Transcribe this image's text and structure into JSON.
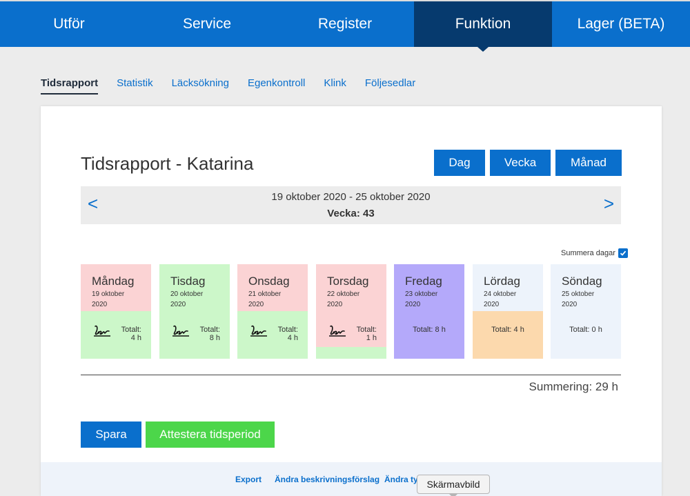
{
  "nav": {
    "items": [
      "Utför",
      "Service",
      "Register",
      "Funktion",
      "Lager (BETA)"
    ],
    "active": "Funktion"
  },
  "subtabs": {
    "items": [
      "Tidsrapport",
      "Statistik",
      "Läcksökning",
      "Egenkontroll",
      "Klink",
      "Följesedlar"
    ],
    "active": "Tidsrapport"
  },
  "report": {
    "title": "Tidsrapport - Katarina",
    "modes": [
      "Dag",
      "Vecka",
      "Månad"
    ],
    "date_range": "19 oktober 2020 - 25 oktober 2020",
    "week_label": "Vecka: 43",
    "prev_icon": "<",
    "next_icon": ">",
    "summera_label": "Summera dagar",
    "summera_checked": true
  },
  "days": [
    {
      "name": "Måndag",
      "date": "19 oktober",
      "year": "2020",
      "total_label": "Totalt:",
      "total": "4 h",
      "signed": true,
      "head_color": "#fbd3d4",
      "body_color": "#ccf7c9"
    },
    {
      "name": "Tisdag",
      "date": "20 oktober",
      "year": "2020",
      "total_label": "Totalt:",
      "total": "8 h",
      "signed": true,
      "head_color": "#ccf7c9",
      "body_color": "#ccf7c9"
    },
    {
      "name": "Onsdag",
      "date": "21 oktober",
      "year": "2020",
      "total_label": "Totalt:",
      "total": "4 h",
      "signed": true,
      "head_color": "#fbd3d4",
      "body_color": "#ccf7c9"
    },
    {
      "name": "Torsdag",
      "date": "22 oktober",
      "year": "2020",
      "total_label": "Totalt:",
      "total": "1 h",
      "signed": true,
      "head_color": "#fbd3d4",
      "body_color": "#fbd3d4",
      "extra_color": "#ccf7c9"
    },
    {
      "name": "Fredag",
      "date": "23 oktober",
      "year": "2020",
      "total_text": "Totalt: 8 h",
      "signed": false,
      "head_color": "#b4a9fa",
      "body_color": "#b4a9fa"
    },
    {
      "name": "Lördag",
      "date": "24 oktober",
      "year": "2020",
      "total_text": "Totalt: 4 h",
      "signed": false,
      "head_color": "#edf3fb",
      "body_color": "#fcd9ad"
    },
    {
      "name": "Söndag",
      "date": "25 oktober",
      "year": "2020",
      "total_text": "Totalt: 0 h",
      "signed": false,
      "head_color": "#edf3fb",
      "body_color": "#edf3fb"
    }
  ],
  "summary": "Summering: 29 h",
  "actions": {
    "save": "Spara",
    "attest": "Attestera tidsperiod"
  },
  "colors": {
    "primary": "#0a6fcc",
    "nav_active": "#063a6e",
    "attest_green": "#4cd64a"
  },
  "footer": {
    "links": [
      "Export",
      "Ändra beskrivningsförslag",
      "Ändra typ"
    ]
  },
  "tooltip": "Skärmavbild"
}
